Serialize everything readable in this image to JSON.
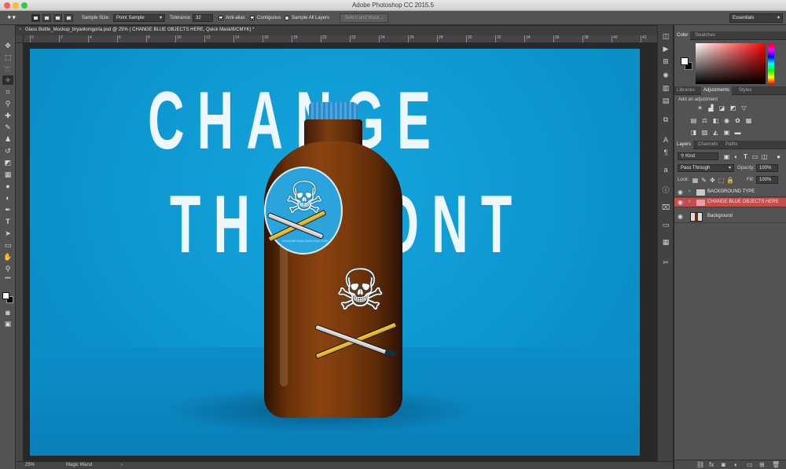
{
  "window": {
    "title": "Adobe Photoshop CC 2015.5"
  },
  "options_bar": {
    "sample_size_label": "Sample Size:",
    "sample_size_value": "Point Sample",
    "tolerance_label": "Tolerance:",
    "tolerance_value": "32",
    "anti_alias_label": "Anti-alias",
    "anti_alias_checked": true,
    "contiguous_label": "Contiguous",
    "contiguous_checked": true,
    "sample_all_layers_label": "Sample All Layers",
    "sample_all_layers_checked": false,
    "select_mask_label": "Select and Mask...",
    "workspace_value": "Essentials"
  },
  "document": {
    "tab_label": "Glass Bottle_Mockup_bryanlomgoria.psd @ 25% ( CHANGE BLUE OBJECTS HERE, Quick Mask/8/CMYK) *",
    "close_glyph": "×",
    "canvas_line1": "CHANGE",
    "canvas_line2": "THE FONT",
    "sticker_ring_text": "WWW.BRYANLOMGORIA.COM",
    "background_color": "#0c93cc"
  },
  "rulers": {
    "top_ticks": [
      "0",
      "2",
      "4",
      "6",
      "8",
      "10",
      "12",
      "14",
      "16",
      "18",
      "20",
      "22",
      "24",
      "26",
      "28",
      "30",
      "32",
      "34",
      "36",
      "38",
      "40",
      "42"
    ]
  },
  "status_bar": {
    "zoom": "25%",
    "tool_name": "Magic Wand",
    "arrow": "›"
  },
  "panels": {
    "color_tabs": [
      "Color",
      "Swatches"
    ],
    "adjust_tabs": [
      "Libraries",
      "Adjustments",
      "Styles"
    ],
    "adjust_heading": "Add an adjustment",
    "layers_tabs": [
      "Layers",
      "Channels",
      "Paths"
    ],
    "kind_label": "Kind",
    "blend_mode": "Pass Through",
    "opacity_label": "Opacity:",
    "opacity_value": "100%",
    "lock_label": "Lock:",
    "fill_label": "Fill:",
    "fill_value": "100%",
    "layers": [
      {
        "name": "BACKGROUND TYPE",
        "type": "group",
        "selected": false
      },
      {
        "name": "CHANGE BLUE OBJECTS HERE",
        "type": "group",
        "selected": true
      },
      {
        "name": "Background",
        "type": "image",
        "selected": false
      }
    ],
    "accent_selected": "#c24e4e"
  },
  "icons": {
    "tools": [
      "move-icon",
      "marquee-icon",
      "lasso-icon",
      "magic-wand-icon",
      "crop-icon",
      "eyedropper-icon",
      "healing-icon",
      "brush-icon",
      "stamp-icon",
      "history-brush-icon",
      "eraser-icon",
      "gradient-icon",
      "blur-icon",
      "dodge-icon",
      "pen-icon",
      "type-icon",
      "path-select-icon",
      "shape-icon",
      "hand-icon",
      "zoom-icon"
    ]
  }
}
